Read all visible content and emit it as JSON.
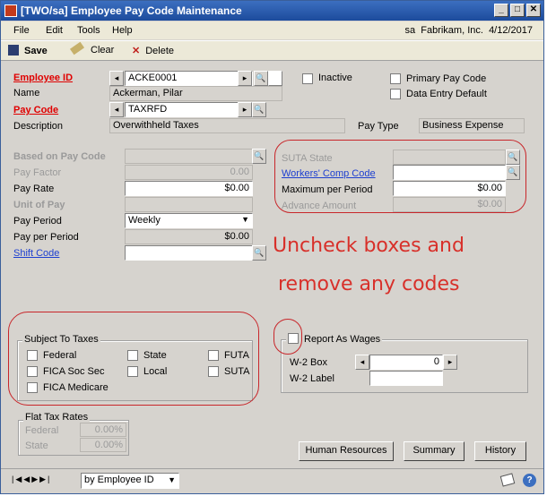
{
  "window": {
    "title": "[TWO/sa] Employee Pay Code Maintenance"
  },
  "menu": {
    "items": [
      "File",
      "Edit",
      "Tools",
      "Help"
    ],
    "user": "sa",
    "company": "Fabrikam, Inc.",
    "date": "4/12/2017"
  },
  "toolbar": {
    "save": "Save",
    "clear": "Clear",
    "delete": "Delete"
  },
  "form": {
    "employee_id_label": "Employee ID",
    "employee_id": "ACKE0001",
    "name_label": "Name",
    "name": "Ackerman, Pilar",
    "pay_code_label": "Pay Code",
    "pay_code": "TAXRFD",
    "description_label": "Description",
    "description": "Overwithheld Taxes",
    "inactive_label": "Inactive",
    "primary_pay_code_label": "Primary Pay Code",
    "data_entry_default_label": "Data Entry Default",
    "pay_type_label": "Pay Type",
    "pay_type": "Business Expense",
    "based_on_label": "Based on Pay Code",
    "pay_factor_label": "Pay Factor",
    "pay_factor": "0.00",
    "pay_rate_label": "Pay Rate",
    "pay_rate": "$0.00",
    "unit_of_pay_label": "Unit of Pay",
    "pay_period_label": "Pay Period",
    "pay_period": "Weekly",
    "pay_per_period_label": "Pay per Period",
    "pay_per_period": "$0.00",
    "shift_code_label": "Shift Code",
    "suta_state_label": "SUTA State",
    "workers_comp_label": "Workers' Comp Code",
    "max_per_period_label": "Maximum per Period",
    "max_per_period": "$0.00",
    "advance_amount_label": "Advance Amount",
    "advance_amount": "$0.00"
  },
  "taxes": {
    "title": "Subject To Taxes",
    "federal": "Federal",
    "fica_soc_sec": "FICA Soc Sec",
    "fica_medicare": "FICA Medicare",
    "state": "State",
    "local": "Local",
    "futa": "FUTA",
    "suta": "SUTA"
  },
  "wages": {
    "report_as_wages": "Report As Wages",
    "w2_box_label": "W-2 Box",
    "w2_box": "0",
    "w2_label_label": "W-2 Label"
  },
  "flat_tax": {
    "title": "Flat Tax Rates",
    "federal_label": "Federal",
    "federal": "0.00%",
    "state_label": "State",
    "state": "0.00%"
  },
  "buttons": {
    "human_resources": "Human Resources",
    "summary": "Summary",
    "history": "History"
  },
  "status": {
    "sort_by": "by Employee ID"
  },
  "annotation": {
    "line1": "Uncheck boxes and",
    "line2": "remove any codes"
  }
}
